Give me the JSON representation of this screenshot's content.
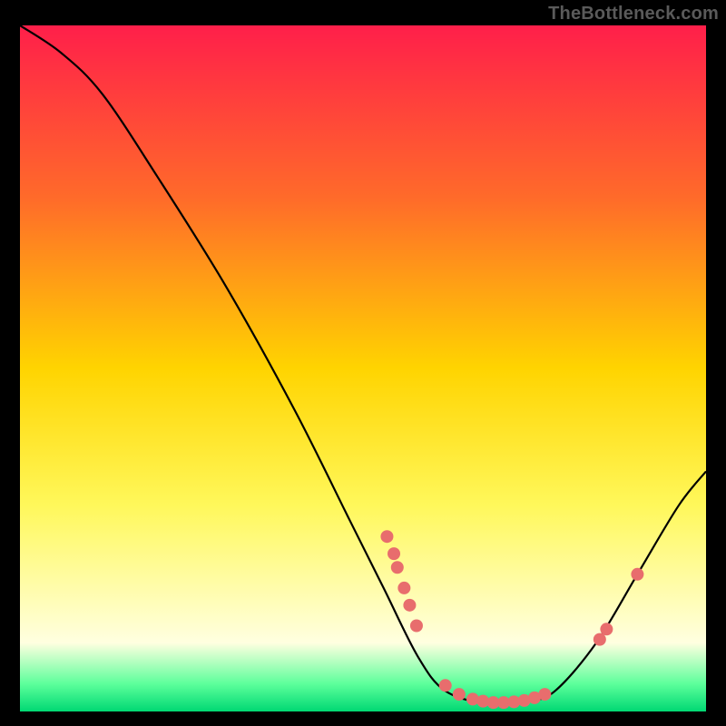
{
  "watermark": "TheBottleneck.com",
  "chart_data": {
    "type": "line",
    "title": "",
    "xlabel": "",
    "ylabel": "",
    "xlim": [
      0,
      100
    ],
    "ylim": [
      0,
      100
    ],
    "grid": false,
    "legend": false,
    "gradient_bands": [
      {
        "y_pct": 0,
        "color": "#ff1f4a"
      },
      {
        "y_pct": 25,
        "color": "#ff6a2a"
      },
      {
        "y_pct": 50,
        "color": "#ffd400"
      },
      {
        "y_pct": 70,
        "color": "#fff85b"
      },
      {
        "y_pct": 90,
        "color": "#ffffe0"
      },
      {
        "y_pct": 96,
        "color": "#5cff9b"
      },
      {
        "y_pct": 100,
        "color": "#00d873"
      }
    ],
    "curve": [
      {
        "x": 0,
        "y": 100
      },
      {
        "x": 6,
        "y": 96
      },
      {
        "x": 12,
        "y": 90
      },
      {
        "x": 20,
        "y": 78
      },
      {
        "x": 30,
        "y": 62
      },
      {
        "x": 40,
        "y": 44
      },
      {
        "x": 48,
        "y": 28
      },
      {
        "x": 53,
        "y": 18
      },
      {
        "x": 58,
        "y": 8
      },
      {
        "x": 62,
        "y": 3
      },
      {
        "x": 68,
        "y": 1.2
      },
      {
        "x": 74,
        "y": 1.5
      },
      {
        "x": 78,
        "y": 3
      },
      {
        "x": 84,
        "y": 10
      },
      {
        "x": 90,
        "y": 20
      },
      {
        "x": 96,
        "y": 30
      },
      {
        "x": 100,
        "y": 35
      }
    ],
    "markers": [
      {
        "x": 53.5,
        "y": 25.5
      },
      {
        "x": 54.5,
        "y": 23.0
      },
      {
        "x": 55.0,
        "y": 21.0
      },
      {
        "x": 56.0,
        "y": 18.0
      },
      {
        "x": 56.8,
        "y": 15.5
      },
      {
        "x": 57.8,
        "y": 12.5
      },
      {
        "x": 62.0,
        "y": 3.8
      },
      {
        "x": 64.0,
        "y": 2.5
      },
      {
        "x": 66.0,
        "y": 1.8
      },
      {
        "x": 67.5,
        "y": 1.5
      },
      {
        "x": 69.0,
        "y": 1.3
      },
      {
        "x": 70.5,
        "y": 1.3
      },
      {
        "x": 72.0,
        "y": 1.4
      },
      {
        "x": 73.5,
        "y": 1.6
      },
      {
        "x": 75.0,
        "y": 2.0
      },
      {
        "x": 76.5,
        "y": 2.5
      },
      {
        "x": 84.5,
        "y": 10.5
      },
      {
        "x": 85.5,
        "y": 12.0
      },
      {
        "x": 90.0,
        "y": 20.0
      }
    ],
    "marker_color": "#e86d6d",
    "curve_color": "#000000"
  }
}
